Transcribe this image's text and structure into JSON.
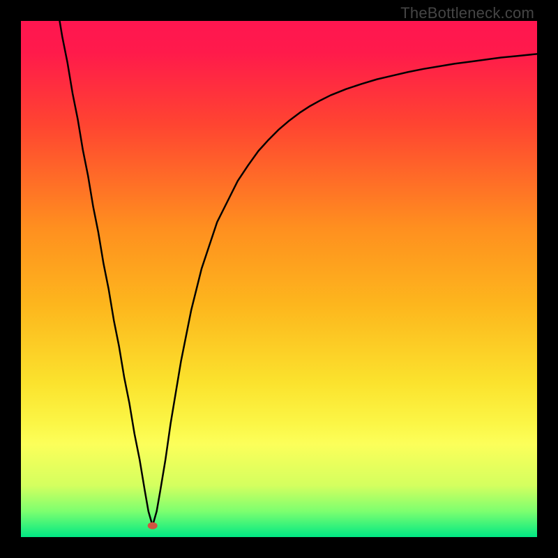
{
  "watermark": "TheBottleneck.com",
  "chart_data": {
    "type": "line",
    "title": "",
    "xlabel": "",
    "ylabel": "",
    "xlim": [
      0,
      100
    ],
    "ylim": [
      0,
      100
    ],
    "grid": false,
    "legend": false,
    "background_gradient": {
      "stops": [
        {
          "offset": 0.0,
          "color": "#ff1650"
        },
        {
          "offset": 0.06,
          "color": "#ff1a4b"
        },
        {
          "offset": 0.2,
          "color": "#ff4431"
        },
        {
          "offset": 0.4,
          "color": "#ff8f1f"
        },
        {
          "offset": 0.55,
          "color": "#fdb61d"
        },
        {
          "offset": 0.7,
          "color": "#fbe22d"
        },
        {
          "offset": 0.78,
          "color": "#fbf646"
        },
        {
          "offset": 0.82,
          "color": "#fcff5a"
        },
        {
          "offset": 0.9,
          "color": "#d4ff5f"
        },
        {
          "offset": 0.95,
          "color": "#7dff6f"
        },
        {
          "offset": 1.0,
          "color": "#00e884"
        }
      ]
    },
    "marker": {
      "x": 25.5,
      "y": 2.2,
      "color": "#d15241",
      "rx": 7,
      "ry": 5
    },
    "series": [
      {
        "name": "curve",
        "color": "#000000",
        "width": 2.5,
        "x": [
          7.5,
          8,
          9,
          10,
          11,
          12,
          13,
          14,
          15,
          16,
          17,
          18,
          19,
          20,
          21,
          22,
          23,
          24,
          24.7,
          25.5,
          26.3,
          27,
          28,
          29,
          30,
          31,
          32,
          33,
          34,
          35,
          36,
          38,
          40,
          42,
          44,
          46,
          48,
          50,
          52,
          54,
          56,
          58,
          60,
          63,
          66,
          69,
          72,
          75,
          78,
          81,
          84,
          87,
          90,
          93,
          96,
          100
        ],
        "y": [
          100,
          97,
          92,
          86,
          81,
          75,
          70,
          64,
          59,
          53,
          48,
          42,
          37,
          31,
          26,
          20,
          15,
          9,
          5,
          2.2,
          5,
          9,
          15,
          22,
          28,
          34,
          39,
          44,
          48,
          52,
          55,
          61,
          65,
          69,
          72,
          74.8,
          77,
          79,
          80.7,
          82.2,
          83.5,
          84.6,
          85.6,
          86.8,
          87.8,
          88.7,
          89.4,
          90.1,
          90.7,
          91.2,
          91.7,
          92.1,
          92.5,
          92.9,
          93.2,
          93.6
        ]
      }
    ]
  }
}
